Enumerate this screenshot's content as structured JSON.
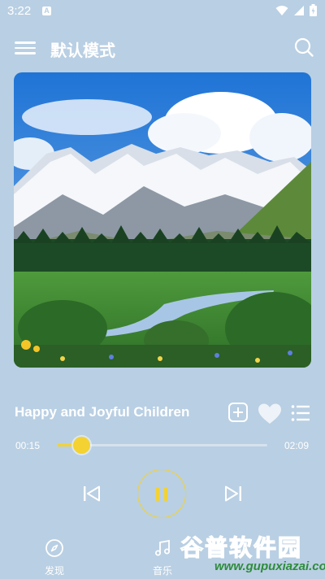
{
  "status_bar": {
    "time": "3:22",
    "notification_badge": "A",
    "icons": [
      "wifi-icon",
      "signal-icon",
      "battery-icon"
    ]
  },
  "header": {
    "title": "默认模式",
    "menu_icon": "menu-icon",
    "search_icon": "search-icon"
  },
  "album": {
    "art": "mountain-landscape-image"
  },
  "song": {
    "title": "Happy and Joyful Children",
    "actions": [
      "add-to-playlist-icon",
      "heart-icon",
      "playlist-icon"
    ]
  },
  "progress": {
    "current_time": "00:15",
    "total_time": "02:09",
    "fraction": 0.116
  },
  "controls": {
    "prev_icon": "skip-previous-icon",
    "play_state": "pause-icon",
    "next_icon": "skip-next-icon"
  },
  "bottom_nav": {
    "items": [
      {
        "label": "发现",
        "icon": "compass-icon"
      },
      {
        "label": "音乐",
        "icon": "music-note-icon"
      }
    ]
  },
  "watermark": {
    "text": "谷普软件园",
    "url": "www.gupuxiazai.com"
  },
  "colors": {
    "background": "#b9cfe3",
    "accent": "#f3d232",
    "text": "#ffffff",
    "watermark_green": "#3fb24a"
  }
}
